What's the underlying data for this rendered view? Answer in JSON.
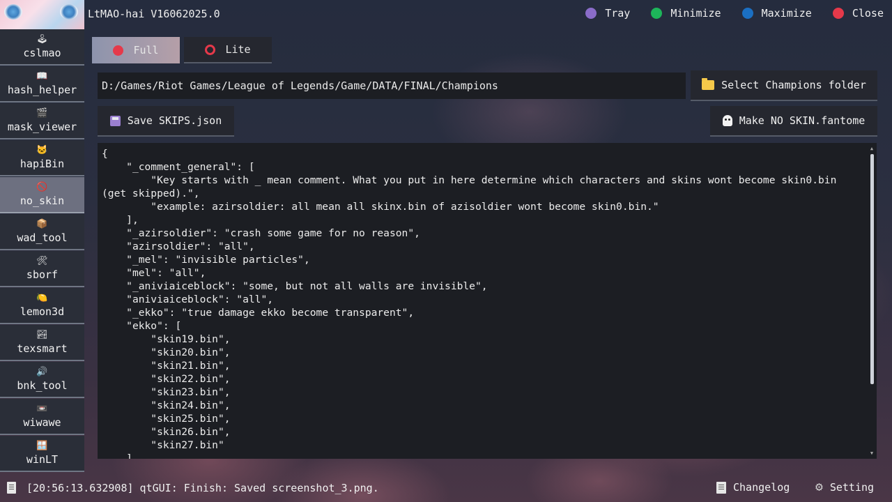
{
  "window": {
    "title": "LtMAO-hai V16062025.0",
    "controls": [
      {
        "label": "Tray",
        "color": "#8a6cc9"
      },
      {
        "label": "Minimize",
        "color": "#1db55a"
      },
      {
        "label": "Maximize",
        "color": "#1b6fc2"
      },
      {
        "label": "Close",
        "color": "#e5394a"
      }
    ]
  },
  "sidebar": {
    "items": [
      {
        "label": "cslmao",
        "icon": "🕹"
      },
      {
        "label": "hash_helper",
        "icon": "📖"
      },
      {
        "label": "mask_viewer",
        "icon": "🎬"
      },
      {
        "label": "hapiBin",
        "icon": "🐱"
      },
      {
        "label": "no_skin",
        "icon": "🚫"
      },
      {
        "label": "wad_tool",
        "icon": "📦"
      },
      {
        "label": "sborf",
        "icon": "🛠"
      },
      {
        "label": "lemon3d",
        "icon": "🍋"
      },
      {
        "label": "texsmart",
        "icon": "🏞"
      },
      {
        "label": "bnk_tool",
        "icon": "🔊"
      },
      {
        "label": "wiwawe",
        "icon": "📼"
      },
      {
        "label": "winLT",
        "icon": "🪟"
      }
    ],
    "active": "no_skin"
  },
  "mode": {
    "full_label": "Full",
    "lite_label": "Lite",
    "selected": "Full"
  },
  "champions_folder": {
    "value": "D:/Games/Riot Games/League of Legends/Game/DATA/FINAL/Champions",
    "select_label": "Select Champions folder"
  },
  "actions": {
    "save_label": "Save SKIPS.json",
    "make_label": "Make NO SKIN.fantome"
  },
  "editor": {
    "content": "{\n    \"_comment_general\": [\n        \"Key starts with _ mean comment. What you put in here determine which characters and skins wont become skin0.bin (get skipped).\",\n        \"example: azirsoldier: all mean all skinx.bin of azisoldier wont become skin0.bin.\"\n    ],\n    \"_azirsoldier\": \"crash some game for no reason\",\n    \"azirsoldier\": \"all\",\n    \"_mel\": \"invisible particles\",\n    \"mel\": \"all\",\n    \"_aniviaiceblock\": \"some, but not all walls are invisible\",\n    \"aniviaiceblock\": \"all\",\n    \"_ekko\": \"true damage ekko become transparent\",\n    \"ekko\": [\n        \"skin19.bin\",\n        \"skin20.bin\",\n        \"skin21.bin\",\n        \"skin22.bin\",\n        \"skin23.bin\",\n        \"skin24.bin\",\n        \"skin25.bin\",\n        \"skin26.bin\",\n        \"skin27.bin\"\n    ],"
  },
  "status": {
    "log": "[20:56:13.632908] qtGUI: Finish: Saved screenshot_3.png.",
    "changelog_label": "Changelog",
    "setting_label": "Setting"
  }
}
